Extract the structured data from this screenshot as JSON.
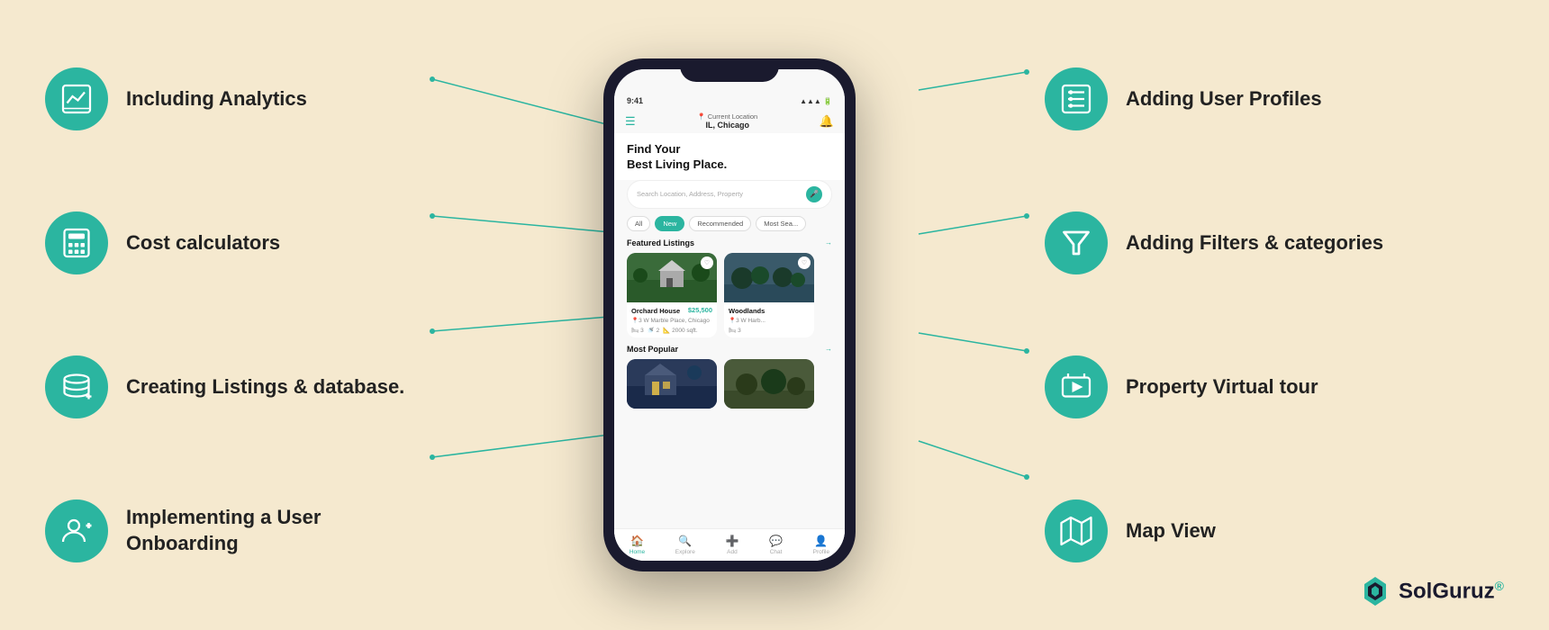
{
  "background_color": "#f5e9cf",
  "left_features": [
    {
      "id": "analytics",
      "icon": "analytics-icon",
      "label": "Including Analytics"
    },
    {
      "id": "calculators",
      "icon": "calculator-icon",
      "label": "Cost calculators"
    },
    {
      "id": "listings",
      "icon": "database-icon",
      "label": "Creating Listings & database."
    },
    {
      "id": "onboarding",
      "icon": "user-add-icon",
      "label": "Implementing a User Onboarding"
    }
  ],
  "right_features": [
    {
      "id": "profiles",
      "icon": "profile-list-icon",
      "label": "Adding User Profiles"
    },
    {
      "id": "filters",
      "icon": "filter-icon",
      "label": "Adding Filters & categories"
    },
    {
      "id": "virtual_tour",
      "icon": "virtual-tour-icon",
      "label": "Property Virtual tour"
    },
    {
      "id": "map_view",
      "icon": "map-icon",
      "label": "Map View"
    }
  ],
  "phone": {
    "status_bar": {
      "time": "9:41",
      "signal": "●●●",
      "battery": "▮▮▮"
    },
    "location": {
      "label": "Current Location",
      "city": "IL, Chicago"
    },
    "hero_title": "Find Your\nBest Living Place.",
    "search_placeholder": "Search Location, Address, Property",
    "chips": [
      "All",
      "New",
      "Recommended",
      "Most Sea..."
    ],
    "active_chip": "New",
    "sections": {
      "featured": "Featured Listings",
      "popular": "Most Popular"
    },
    "cards": [
      {
        "name": "Orchard House",
        "price": "$25,500",
        "address": "3 W Marble Place, Chicago",
        "beds": "3",
        "baths": "2",
        "sqft": "2000 sqft."
      },
      {
        "name": "Woodlands",
        "price": "",
        "address": "3 W Harb...",
        "beds": "3",
        "baths": "",
        "sqft": ""
      }
    ],
    "nav_items": [
      "Home",
      "Explore",
      "Add",
      "Chat",
      "Profile"
    ]
  },
  "logo": {
    "text": "SolGuruz",
    "trademark": "®"
  }
}
